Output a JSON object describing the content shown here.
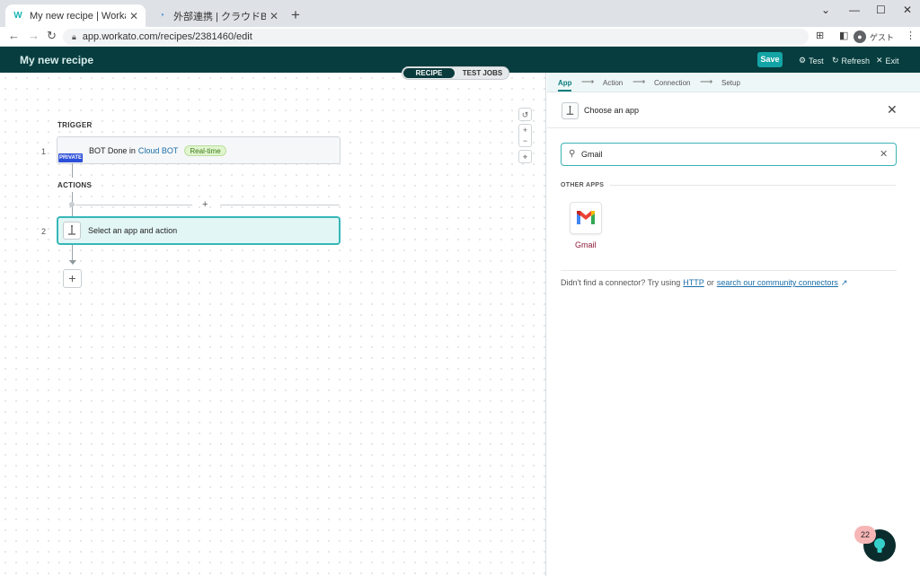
{
  "browser": {
    "tabs": [
      {
        "title": "My new recipe | Workato",
        "active": true
      },
      {
        "title": "外部連携 | クラウドBOT",
        "active": false
      }
    ],
    "url": "app.workato.com/recipes/2381460/edit",
    "profile_label": "ゲスト"
  },
  "header": {
    "recipe_title": "My new recipe",
    "save_label": "Save",
    "test_label": "Test",
    "refresh_label": "Refresh",
    "exit_label": "Exit"
  },
  "canvas": {
    "toggle": {
      "recipe": "RECIPE",
      "test_jobs": "TEST JOBS"
    },
    "trigger_label": "TRIGGER",
    "actions_label": "ACTIONS",
    "step1": {
      "number": "1",
      "text_pre": "BOT Done in",
      "app": "Cloud BOT",
      "badge": "Real-time",
      "private_badge": "PRIVATE"
    },
    "step2": {
      "number": "2",
      "text": "Select an app and action"
    },
    "add_symbol": "+"
  },
  "panel": {
    "steps": [
      "App",
      "Action",
      "Connection",
      "Setup"
    ],
    "active_step": "App",
    "choose_title": "Choose an app",
    "search_value": "Gmail",
    "section_label": "OTHER APPS",
    "apps": [
      {
        "name": "Gmail",
        "icon": "gmail-icon"
      }
    ],
    "not_found_text": "Didn't find a connector? Try using",
    "http_link": "HTTP",
    "or_text": "or",
    "community_link": "search our community connectors"
  },
  "help": {
    "badge_count": "22"
  },
  "colors": {
    "header_bg": "#073d3e",
    "accent": "#14a4a5",
    "private_badge": "#2d4fd8"
  }
}
